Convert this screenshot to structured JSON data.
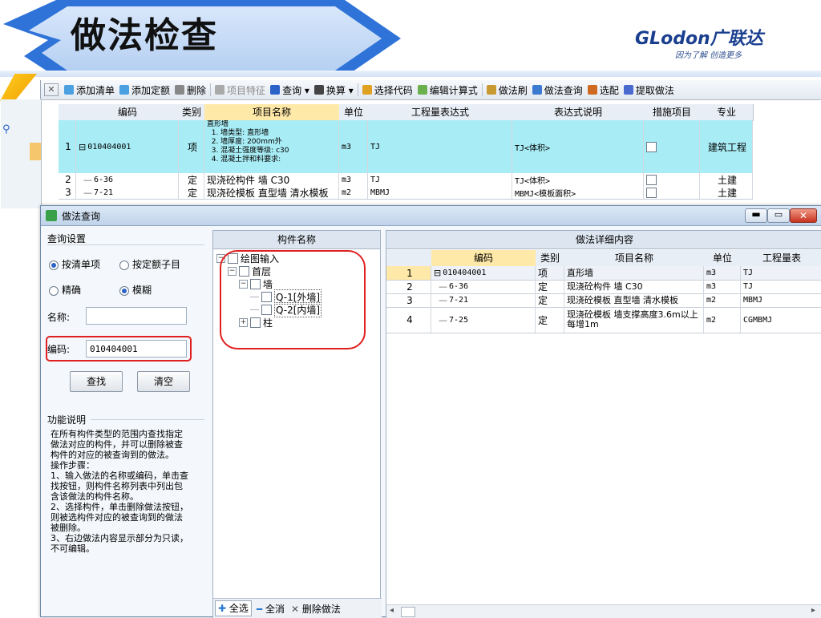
{
  "slide": {
    "title": "做法检查",
    "brand": "GLodon广联达",
    "tagline": "因为了解 创造更多"
  },
  "toolbar": [
    {
      "label": "添加清单"
    },
    {
      "label": "添加定额"
    },
    {
      "label": "删除"
    },
    {
      "label": "项目特征"
    },
    {
      "label": "查询 ▾"
    },
    {
      "label": "换算 ▾"
    },
    {
      "label": "选择代码"
    },
    {
      "label": "编辑计算式"
    },
    {
      "label": "做法刷"
    },
    {
      "label": "做法查询"
    },
    {
      "label": "选配"
    },
    {
      "label": "提取做法"
    }
  ],
  "top_table": {
    "headers": [
      "编码",
      "类别",
      "项目名称",
      "单位",
      "工程量表达式",
      "表达式说明",
      "措施项目",
      "专业"
    ],
    "rows": [
      {
        "n": "1",
        "code": "010404001",
        "type": "项",
        "name": "直形墙\n  1. 墙类型: 直形墙\n  2. 墙厚度: 200mm外\n  3. 混凝土强度等级: c30\n  4. 混凝土拌和料要求:",
        "unit": "m3",
        "expr": "TJ",
        "desc": "TJ<体积>",
        "spec": "建筑工程"
      },
      {
        "n": "2",
        "code": "6-36",
        "type": "定",
        "name": "现浇砼构件 墙 C30",
        "unit": "m3",
        "expr": "TJ",
        "desc": "TJ<体积>",
        "spec": "土建"
      },
      {
        "n": "3",
        "code": "7-21",
        "type": "定",
        "name": "现浇砼模板 直型墙 清水模板",
        "unit": "m2",
        "expr": "MBMJ",
        "desc": "MBMJ<模板面积>",
        "spec": "土建"
      }
    ]
  },
  "dialog": {
    "title": "做法查询",
    "query_settings": "查询设置",
    "radio_by_item": "按清单项",
    "radio_by_quota": "按定额子目",
    "radio_exact": "精确",
    "radio_fuzzy": "模糊",
    "name_label": "名称:",
    "name_value": "",
    "code_label": "编码:",
    "code_value": "010404001",
    "find_button": "查找",
    "clear_button": "清空",
    "func_title": "功能说明",
    "func_text": "在所有构件类型的范围内查找指定做法对应的构件，并可以删除被查构件的对应的被查询到的做法。\n操作步骤：\n1、输入做法的名称或编码，单击查找按钮，则构件名称列表中列出包含该做法的构件名称。\n2、选择构件，单击删除做法按钮，则被选构件对应的被查询到的做法被删除。\n3、右边做法内容显示部分为只读，不可编辑。",
    "component_panel_title": "构件名称",
    "tree": [
      {
        "label": "绘图输入",
        "level": 0,
        "toggle": "−"
      },
      {
        "label": "首层",
        "level": 1,
        "toggle": "−"
      },
      {
        "label": "墙",
        "level": 2,
        "toggle": "−"
      },
      {
        "label": "Q-1[外墙]",
        "level": 3,
        "toggle": ""
      },
      {
        "label": "Q-2[内墙]",
        "level": 3,
        "toggle": ""
      },
      {
        "label": "柱",
        "level": 2,
        "toggle": "+"
      }
    ],
    "select_all": "全选",
    "deselect_all": "全消",
    "delete_method": "删除做法",
    "detail_title": "做法详细内容",
    "detail_headers": [
      "编码",
      "类别",
      "项目名称",
      "单位",
      "工程量表"
    ],
    "detail_rows": [
      {
        "n": "1",
        "code": "010404001",
        "type": "项",
        "name": "直形墙",
        "unit": "m3",
        "expr": "TJ"
      },
      {
        "n": "2",
        "code": "6-36",
        "type": "定",
        "name": "现浇砼构件 墙 C30",
        "unit": "m3",
        "expr": "TJ"
      },
      {
        "n": "3",
        "code": "7-21",
        "type": "定",
        "name": "现浇砼模板 直型墙 清水模板",
        "unit": "m2",
        "expr": "MBMJ"
      },
      {
        "n": "4",
        "code": "7-25",
        "type": "定",
        "name": "现浇砼模板 墙支撑高度3.6m以上每增1m",
        "unit": "m2",
        "expr": "CGMBMJ"
      }
    ]
  },
  "colors": {
    "highlight_row": "#a8ecf5",
    "highlight_header": "#ffe9a8",
    "red_annotation": "#e02020",
    "title_arrow_blue": "#2f73d8",
    "brand_blue": "#1a3f8f"
  }
}
